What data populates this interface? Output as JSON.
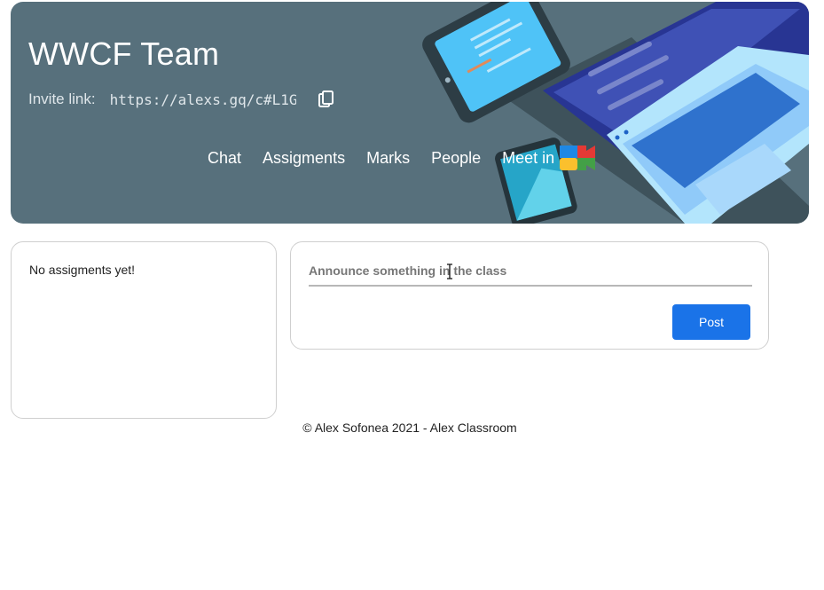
{
  "class": {
    "title": "WWCF Team",
    "invite_label": "Invite link:",
    "invite_link": "https://alexs.gq/c#L1G"
  },
  "nav": {
    "items": [
      "Chat",
      "Assigments",
      "Marks",
      "People"
    ],
    "meet_label": "Meet in"
  },
  "assignments": {
    "empty_text": "No assigments yet!"
  },
  "announce": {
    "placeholder": "Announce something in the class",
    "post_label": "Post"
  },
  "footer": {
    "text": "© Alex Sofonea 2021 - Alex Classroom"
  },
  "icons": [
    "copy-icon",
    "google-meet-icon"
  ],
  "colors": {
    "banner": "#57707c",
    "post_button": "#1a73e8"
  }
}
